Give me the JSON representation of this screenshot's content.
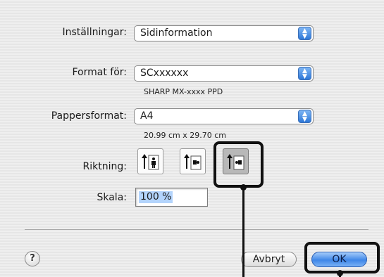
{
  "settings": {
    "label": "Inställningar:",
    "value": "Sidinformation"
  },
  "format_for": {
    "label": "Format för:",
    "value": "SCxxxxxx",
    "sub": "SHARP MX-xxxx PPD"
  },
  "paper": {
    "label": "Pappersformat:",
    "value": "A4",
    "sub": "20.99 cm x 29.70 cm"
  },
  "orientation": {
    "label": "Riktning:",
    "options": [
      {
        "name": "portrait",
        "selected": false
      },
      {
        "name": "landscape-left",
        "selected": false
      },
      {
        "name": "landscape-right",
        "selected": true
      }
    ]
  },
  "scale": {
    "label": "Skala:",
    "value": "100 %"
  },
  "buttons": {
    "help": "?",
    "cancel": "Avbryt",
    "ok": "OK"
  },
  "colors": {
    "accent": "#3f87e8",
    "callout": "#111111"
  }
}
